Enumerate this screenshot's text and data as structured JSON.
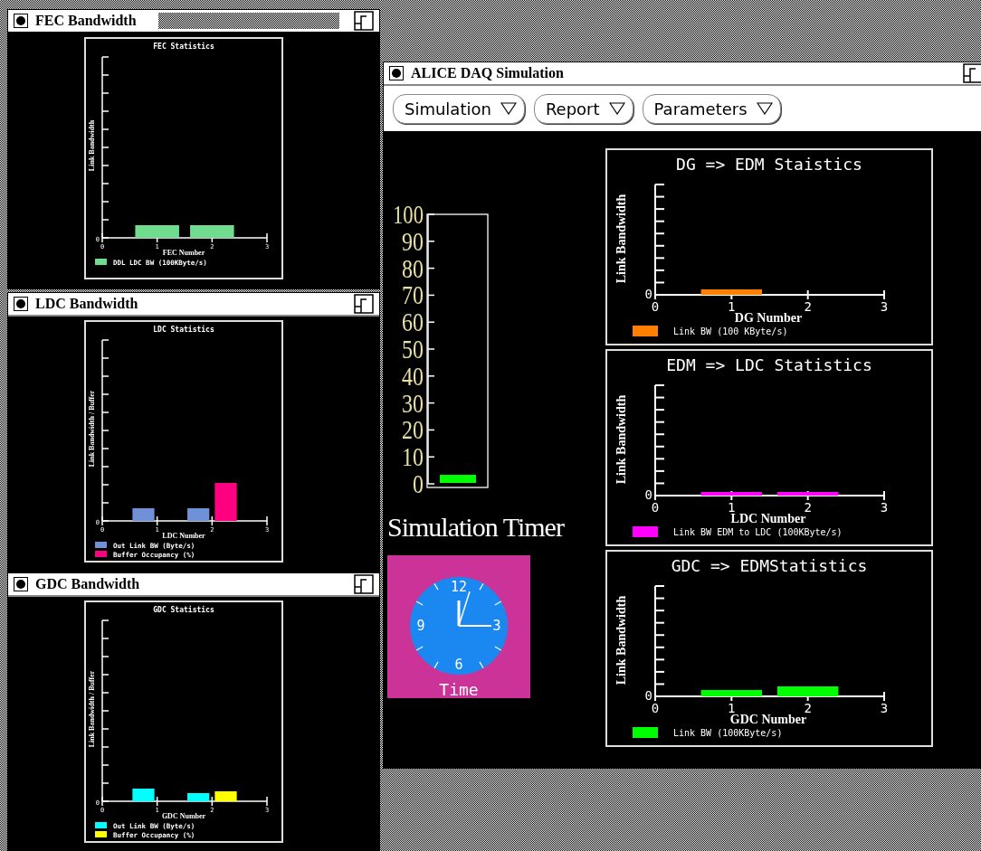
{
  "side_windows": [
    {
      "title": "FEC Bandwidth",
      "active": true,
      "chart": {
        "title": "FEC Statistics",
        "ylabel": "Link Bandwidth",
        "xlabel": "FEC Number",
        "y_zero": "0",
        "x_ticks": [
          "0",
          "1",
          "2",
          "3"
        ],
        "legend": [
          {
            "label": "DDL LDC BW (100KByte/s)",
            "color": "#70dc90"
          }
        ]
      }
    },
    {
      "title": "LDC Bandwidth",
      "active": false,
      "chart": {
        "title": "LDC Statistics",
        "ylabel": "Link Bandwidth / Buffer",
        "xlabel": "LDC Number",
        "y_zero": "0",
        "x_ticks": [
          "0",
          "1",
          "2",
          "3"
        ],
        "legend": [
          {
            "label": "Out Link BW (Byte/s)",
            "color": "#7090d8"
          },
          {
            "label": "Buffer Occupancy (%)",
            "color": "#ff0080"
          }
        ]
      }
    },
    {
      "title": "GDC Bandwidth",
      "active": false,
      "chart": {
        "title": "GDC Statistics",
        "ylabel": "Link Bandwidth / Buffer",
        "xlabel": "GDC Number",
        "y_zero": "0",
        "x_ticks": [
          "0",
          "1",
          "2",
          "3"
        ],
        "legend": [
          {
            "label": "Out Link BW (Byte/s)",
            "color": "#00ffff"
          },
          {
            "label": "Buffer Occupancy (%)",
            "color": "#ffff00"
          }
        ]
      }
    }
  ],
  "main_window": {
    "title": "ALICE DAQ Simulation",
    "menus": [
      {
        "label": "Simulation"
      },
      {
        "label": "Report"
      },
      {
        "label": "Parameters"
      }
    ],
    "gauge": {
      "labels": [
        "100",
        "90",
        "80",
        "70",
        "60",
        "50",
        "40",
        "30",
        "20",
        "10",
        "0"
      ],
      "level": 0.03
    },
    "timer_label": "Simulation Timer",
    "clock": {
      "numbers": [
        "12",
        "3",
        "6",
        "9"
      ],
      "caption": "Time"
    },
    "charts": [
      {
        "title": "DG => EDM Staistics",
        "ylabel": "Link Bandwidth",
        "xlabel": "DG Number",
        "y_zero": "0",
        "x_ticks": [
          "0",
          "1",
          "2",
          "3"
        ],
        "legend": [
          {
            "label": "Link BW (100 KByte/s)",
            "color": "#ff8000"
          }
        ]
      },
      {
        "title": "EDM => LDC Statistics",
        "ylabel": "Link Bandwidth",
        "xlabel": "LDC Number",
        "y_zero": "0",
        "x_ticks": [
          "0",
          "1",
          "2",
          "3"
        ],
        "legend": [
          {
            "label": "Link BW EDM to LDC (100KByte/s)",
            "color": "#ff00ff"
          }
        ]
      },
      {
        "title": "GDC => EDMStatistics",
        "ylabel": "Link Bandwidth",
        "xlabel": "GDC Number",
        "y_zero": "0",
        "x_ticks": [
          "0",
          "1",
          "2",
          "3"
        ],
        "legend": [
          {
            "label": "Link BW (100KByte/s)",
            "color": "#00ff00"
          }
        ]
      }
    ]
  }
}
